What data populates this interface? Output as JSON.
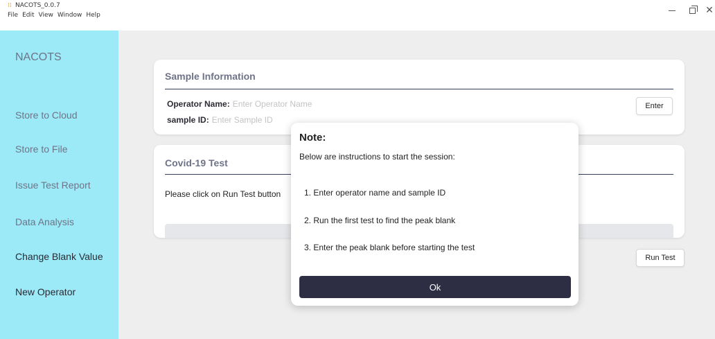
{
  "window": {
    "title": "NACOTS_0.0.7",
    "menu": [
      "File",
      "Edit",
      "View",
      "Window",
      "Help"
    ],
    "controls": {
      "minimize": "—",
      "close": "✕"
    }
  },
  "sidebar": {
    "brand": "NACOTS",
    "items": [
      {
        "label": "Store to Cloud"
      },
      {
        "label": "Store to File"
      },
      {
        "label": "Issue Test Report"
      },
      {
        "label": "Data Analysis"
      },
      {
        "label": "Change Blank Value"
      },
      {
        "label": "New Operator"
      }
    ]
  },
  "sample_info": {
    "title": "Sample Information",
    "operator_label": "Operator Name:",
    "operator_placeholder": "Enter Operator Name",
    "operator_value": "",
    "sample_label": "sample ID:",
    "sample_placeholder": "Enter Sample ID",
    "sample_value": "",
    "enter_button": "Enter"
  },
  "covid_test": {
    "title": "Covid-19 Test",
    "instruction": "Please click on Run Test button",
    "progress_fraction": 0,
    "run_button": "Run Test"
  },
  "note_modal": {
    "title": "Note:",
    "intro": "Below are instructions to start the session:",
    "steps": [
      "1. Enter operator name and sample ID",
      "2. Run the first test to find the peak blank",
      "3. Enter the peak blank before starting the test"
    ],
    "ok_button": "Ok"
  },
  "colors": {
    "sidebar_bg": "#9ceaf7",
    "muted_text": "#6f7387",
    "primary_button": "#2d2d44",
    "rule": "#353b5a"
  }
}
